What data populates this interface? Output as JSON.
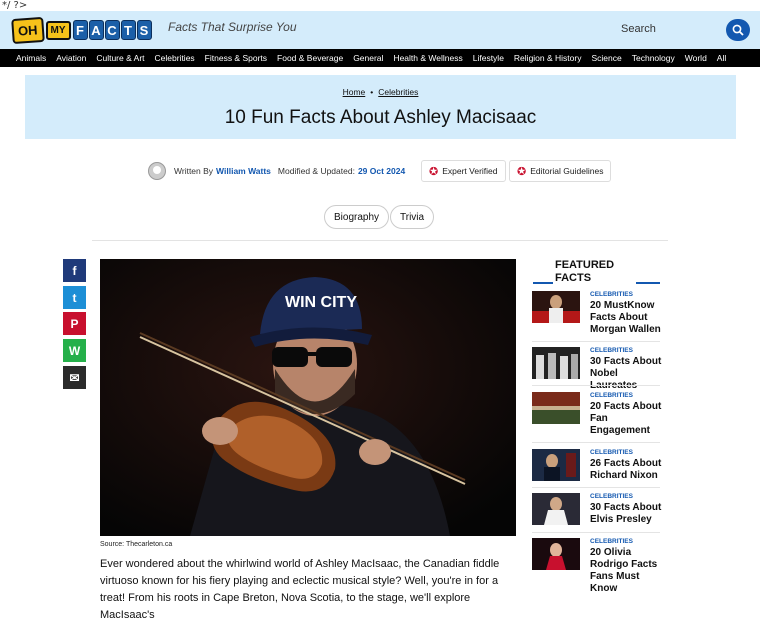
{
  "stray_text": "*/ ?>",
  "brand": {
    "logo_oh": "OH",
    "logo_my": "MY",
    "logo_facts": [
      "F",
      "A",
      "C",
      "T",
      "S"
    ],
    "tagline": "Facts That Surprise You"
  },
  "search": {
    "label": "Search"
  },
  "nav": [
    "Animals",
    "Aviation",
    "Culture & Art",
    "Celebrities",
    "Fitness & Sports",
    "Food & Beverage",
    "General",
    "Health & Wellness",
    "Lifestyle",
    "Religion & History",
    "Science",
    "Technology",
    "World",
    "All"
  ],
  "breadcrumb": {
    "home": "Home",
    "section": "Celebrities"
  },
  "article": {
    "title": "10 Fun Facts About Ashley Macisaac",
    "written_by": "Written By",
    "author": "William Watts",
    "modified_label": "Modified & Updated:",
    "date": "29 Oct 2024",
    "badges": [
      "Expert Verified",
      "Editorial Guidelines"
    ],
    "tags": [
      "Biography",
      "Trivia"
    ],
    "image_source": "Source: Thecarleton.ca",
    "cap_text": "WIN CITY",
    "body": "Ever wondered about the whirlwind world of Ashley MacIsaac, the Canadian fiddle virtuoso known for his fiery playing and eclectic musical style? Well, you're in for a treat! From his roots in Cape Breton, Nova Scotia, to the stage, we'll explore MacIsaac's"
  },
  "share": [
    "f",
    "t",
    "P",
    "W",
    "✉"
  ],
  "featured": {
    "title_line1": "FEATURED",
    "title_line2": "FACTS",
    "items": [
      {
        "category": "CELEBRITIES",
        "title": "20 MustKnow Facts About Morgan Wallen"
      },
      {
        "category": "CELEBRITIES",
        "title": "30 Facts About Nobel Laureates"
      },
      {
        "category": "CELEBRITIES",
        "title": "20 Facts About Fan Engagement"
      },
      {
        "category": "CELEBRITIES",
        "title": "26 Facts About Richard Nixon"
      },
      {
        "category": "CELEBRITIES",
        "title": "30 Facts About Elvis Presley"
      },
      {
        "category": "CELEBRITIES",
        "title": "20 Olivia Rodrigo Facts Fans Must Know"
      }
    ]
  },
  "colors": {
    "light_blue": "#d4ecfb",
    "accent_blue": "#1358b0",
    "nav_black": "#000000",
    "badge_red": "#c8102e"
  }
}
